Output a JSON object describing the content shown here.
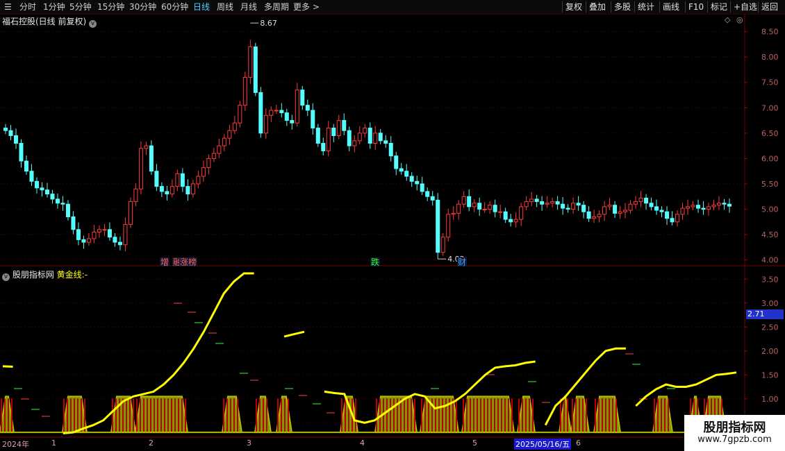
{
  "toolbar": {
    "left": [
      {
        "label": "分时",
        "x": 28
      },
      {
        "label": "1分钟",
        "x": 62
      },
      {
        "label": "5分钟",
        "x": 100
      },
      {
        "label": "15分钟",
        "x": 140
      },
      {
        "label": "30分钟",
        "x": 186
      },
      {
        "label": "60分钟",
        "x": 232
      },
      {
        "label": "日线",
        "x": 278,
        "active": true
      },
      {
        "label": "周线",
        "x": 312
      },
      {
        "label": "月线",
        "x": 346
      },
      {
        "label": "多周期",
        "x": 380
      },
      {
        "label": "更多 >",
        "x": 422
      }
    ],
    "right": [
      {
        "label": "复权",
        "x": 814
      },
      {
        "label": "叠加",
        "x": 848
      },
      {
        "label": "多股",
        "x": 884
      },
      {
        "label": "统计",
        "x": 918
      },
      {
        "label": "画线",
        "x": 954
      },
      {
        "label": "F10",
        "x": 991
      },
      {
        "label": "标记",
        "x": 1023
      },
      {
        "label": "+自选",
        "x": 1056
      },
      {
        "label": "返回",
        "x": 1096
      }
    ]
  },
  "main_title": "福石控股(日线 前复权)",
  "indicator_title": {
    "name": "股朋指标网",
    "series": "黄金线:",
    "value": "-"
  },
  "current_value": "2.71",
  "main_axis": [
    "8.50",
    "8.00",
    "7.50",
    "7.00",
    "6.50",
    "6.00",
    "5.50",
    "5.00",
    "4.50",
    "4.00"
  ],
  "ind_axis": [
    "3.50",
    "3.00",
    "2.50",
    "2.00",
    "1.50",
    "1.00",
    "0.50"
  ],
  "high_label": "8.67",
  "low_label": "4.02",
  "markers": [
    {
      "text": "增",
      "color": "#ff6060"
    },
    {
      "text": "融",
      "color": "#ff6060"
    },
    {
      "text": "涨榜",
      "color": "#ff6060"
    },
    {
      "text": "跌",
      "color": "#30ff30"
    },
    {
      "text": "财",
      "color": "#40a0ff"
    }
  ],
  "time_axis": [
    {
      "label": "2024年"
    },
    {
      "label": "1"
    },
    {
      "label": "2"
    },
    {
      "label": "3"
    },
    {
      "label": "4"
    },
    {
      "label": "5"
    },
    {
      "label": "2025/05/16/五",
      "date": true
    },
    {
      "label": "6"
    }
  ],
  "watermark": {
    "line1": "股朋指标网",
    "line2": "www.7gpzb.com"
  },
  "chart_data": {
    "type": "candlestick",
    "price_range": [
      3.9,
      8.85
    ],
    "price_close_series": [
      6.55,
      6.45,
      6.3,
      5.95,
      5.75,
      5.55,
      5.42,
      5.38,
      5.3,
      5.2,
      5.12,
      5.1,
      4.85,
      4.6,
      4.4,
      4.35,
      4.42,
      4.55,
      4.6,
      4.6,
      4.45,
      4.35,
      4.3,
      4.7,
      5.15,
      5.4,
      6.2,
      6.25,
      5.75,
      5.45,
      5.35,
      5.3,
      5.45,
      5.7,
      5.45,
      5.3,
      5.5,
      5.65,
      5.82,
      6.0,
      6.1,
      6.25,
      6.4,
      6.55,
      6.7,
      7.05,
      7.6,
      8.2,
      7.3,
      6.5,
      6.85,
      6.95,
      6.95,
      6.9,
      6.75,
      6.7,
      7.35,
      7.05,
      6.95,
      6.6,
      6.3,
      6.15,
      6.6,
      6.45,
      6.75,
      6.55,
      6.25,
      6.35,
      6.5,
      6.6,
      6.3,
      6.5,
      6.35,
      6.3,
      6.05,
      5.8,
      5.75,
      5.65,
      5.55,
      5.5,
      5.35,
      5.25,
      5.18,
      4.15,
      4.45,
      4.9,
      4.92,
      5.1,
      5.25,
      5.05,
      5.12,
      5.0,
      5.0,
      5.08,
      4.95,
      4.95,
      4.8,
      4.75,
      4.8,
      5.05,
      5.15,
      5.2,
      5.15,
      5.1,
      5.12,
      5.15,
      5.1,
      5.02,
      5.0,
      5.12,
      5.08,
      4.95,
      4.82,
      4.85,
      4.9,
      5.05,
      5.08,
      4.92,
      4.95,
      4.98,
      5.1,
      5.15,
      5.22,
      5.12,
      5.05,
      4.98,
      4.95,
      4.82,
      4.75,
      4.9,
      5.02,
      5.05,
      5.08,
      5.02,
      5.0,
      5.05,
      5.08,
      5.12,
      5.1,
      5.06
    ],
    "indicator_range": [
      0.2,
      3.75
    ],
    "golden_line": [
      1.68,
      1.67,
      null,
      null,
      null,
      null,
      0.28,
      0.3,
      0.38,
      0.45,
      0.55,
      0.75,
      0.95,
      1.05,
      1.1,
      1.15,
      1.3,
      1.5,
      1.75,
      2.05,
      2.4,
      2.8,
      3.2,
      3.45,
      3.62,
      3.62,
      null,
      null,
      2.3,
      2.35,
      2.4,
      null,
      1.15,
      1.12,
      1.1,
      0.55,
      0.5,
      0.55,
      0.7,
      0.85,
      1.0,
      1.1,
      1.05,
      0.8,
      0.85,
      0.95,
      1.1,
      1.3,
      1.5,
      1.65,
      1.68,
      1.7,
      1.75,
      1.78,
      0.45,
      0.85,
      1.05,
      1.3,
      1.55,
      1.8,
      2.0,
      2.05,
      2.05,
      0.85,
      1.05,
      1.2,
      1.3,
      1.25,
      1.25,
      1.3,
      1.4,
      1.5,
      1.52,
      1.55
    ]
  }
}
